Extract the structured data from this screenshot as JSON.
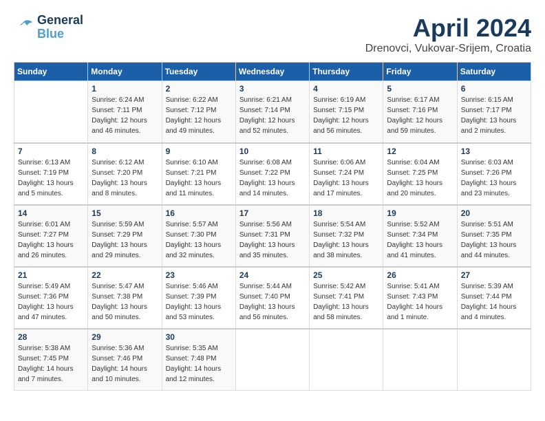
{
  "logo": {
    "line1": "General",
    "line2": "Blue"
  },
  "title": "April 2024",
  "subtitle": "Drenovci, Vukovar-Srijem, Croatia",
  "days_of_week": [
    "Sunday",
    "Monday",
    "Tuesday",
    "Wednesday",
    "Thursday",
    "Friday",
    "Saturday"
  ],
  "weeks": [
    [
      {
        "day": "",
        "info": ""
      },
      {
        "day": "1",
        "info": "Sunrise: 6:24 AM\nSunset: 7:11 PM\nDaylight: 12 hours\nand 46 minutes."
      },
      {
        "day": "2",
        "info": "Sunrise: 6:22 AM\nSunset: 7:12 PM\nDaylight: 12 hours\nand 49 minutes."
      },
      {
        "day": "3",
        "info": "Sunrise: 6:21 AM\nSunset: 7:14 PM\nDaylight: 12 hours\nand 52 minutes."
      },
      {
        "day": "4",
        "info": "Sunrise: 6:19 AM\nSunset: 7:15 PM\nDaylight: 12 hours\nand 56 minutes."
      },
      {
        "day": "5",
        "info": "Sunrise: 6:17 AM\nSunset: 7:16 PM\nDaylight: 12 hours\nand 59 minutes."
      },
      {
        "day": "6",
        "info": "Sunrise: 6:15 AM\nSunset: 7:17 PM\nDaylight: 13 hours\nand 2 minutes."
      }
    ],
    [
      {
        "day": "7",
        "info": "Sunrise: 6:13 AM\nSunset: 7:19 PM\nDaylight: 13 hours\nand 5 minutes."
      },
      {
        "day": "8",
        "info": "Sunrise: 6:12 AM\nSunset: 7:20 PM\nDaylight: 13 hours\nand 8 minutes."
      },
      {
        "day": "9",
        "info": "Sunrise: 6:10 AM\nSunset: 7:21 PM\nDaylight: 13 hours\nand 11 minutes."
      },
      {
        "day": "10",
        "info": "Sunrise: 6:08 AM\nSunset: 7:22 PM\nDaylight: 13 hours\nand 14 minutes."
      },
      {
        "day": "11",
        "info": "Sunrise: 6:06 AM\nSunset: 7:24 PM\nDaylight: 13 hours\nand 17 minutes."
      },
      {
        "day": "12",
        "info": "Sunrise: 6:04 AM\nSunset: 7:25 PM\nDaylight: 13 hours\nand 20 minutes."
      },
      {
        "day": "13",
        "info": "Sunrise: 6:03 AM\nSunset: 7:26 PM\nDaylight: 13 hours\nand 23 minutes."
      }
    ],
    [
      {
        "day": "14",
        "info": "Sunrise: 6:01 AM\nSunset: 7:27 PM\nDaylight: 13 hours\nand 26 minutes."
      },
      {
        "day": "15",
        "info": "Sunrise: 5:59 AM\nSunset: 7:29 PM\nDaylight: 13 hours\nand 29 minutes."
      },
      {
        "day": "16",
        "info": "Sunrise: 5:57 AM\nSunset: 7:30 PM\nDaylight: 13 hours\nand 32 minutes."
      },
      {
        "day": "17",
        "info": "Sunrise: 5:56 AM\nSunset: 7:31 PM\nDaylight: 13 hours\nand 35 minutes."
      },
      {
        "day": "18",
        "info": "Sunrise: 5:54 AM\nSunset: 7:32 PM\nDaylight: 13 hours\nand 38 minutes."
      },
      {
        "day": "19",
        "info": "Sunrise: 5:52 AM\nSunset: 7:34 PM\nDaylight: 13 hours\nand 41 minutes."
      },
      {
        "day": "20",
        "info": "Sunrise: 5:51 AM\nSunset: 7:35 PM\nDaylight: 13 hours\nand 44 minutes."
      }
    ],
    [
      {
        "day": "21",
        "info": "Sunrise: 5:49 AM\nSunset: 7:36 PM\nDaylight: 13 hours\nand 47 minutes."
      },
      {
        "day": "22",
        "info": "Sunrise: 5:47 AM\nSunset: 7:38 PM\nDaylight: 13 hours\nand 50 minutes."
      },
      {
        "day": "23",
        "info": "Sunrise: 5:46 AM\nSunset: 7:39 PM\nDaylight: 13 hours\nand 53 minutes."
      },
      {
        "day": "24",
        "info": "Sunrise: 5:44 AM\nSunset: 7:40 PM\nDaylight: 13 hours\nand 56 minutes."
      },
      {
        "day": "25",
        "info": "Sunrise: 5:42 AM\nSunset: 7:41 PM\nDaylight: 13 hours\nand 58 minutes."
      },
      {
        "day": "26",
        "info": "Sunrise: 5:41 AM\nSunset: 7:43 PM\nDaylight: 14 hours\nand 1 minute."
      },
      {
        "day": "27",
        "info": "Sunrise: 5:39 AM\nSunset: 7:44 PM\nDaylight: 14 hours\nand 4 minutes."
      }
    ],
    [
      {
        "day": "28",
        "info": "Sunrise: 5:38 AM\nSunset: 7:45 PM\nDaylight: 14 hours\nand 7 minutes."
      },
      {
        "day": "29",
        "info": "Sunrise: 5:36 AM\nSunset: 7:46 PM\nDaylight: 14 hours\nand 10 minutes."
      },
      {
        "day": "30",
        "info": "Sunrise: 5:35 AM\nSunset: 7:48 PM\nDaylight: 14 hours\nand 12 minutes."
      },
      {
        "day": "",
        "info": ""
      },
      {
        "day": "",
        "info": ""
      },
      {
        "day": "",
        "info": ""
      },
      {
        "day": "",
        "info": ""
      }
    ]
  ]
}
